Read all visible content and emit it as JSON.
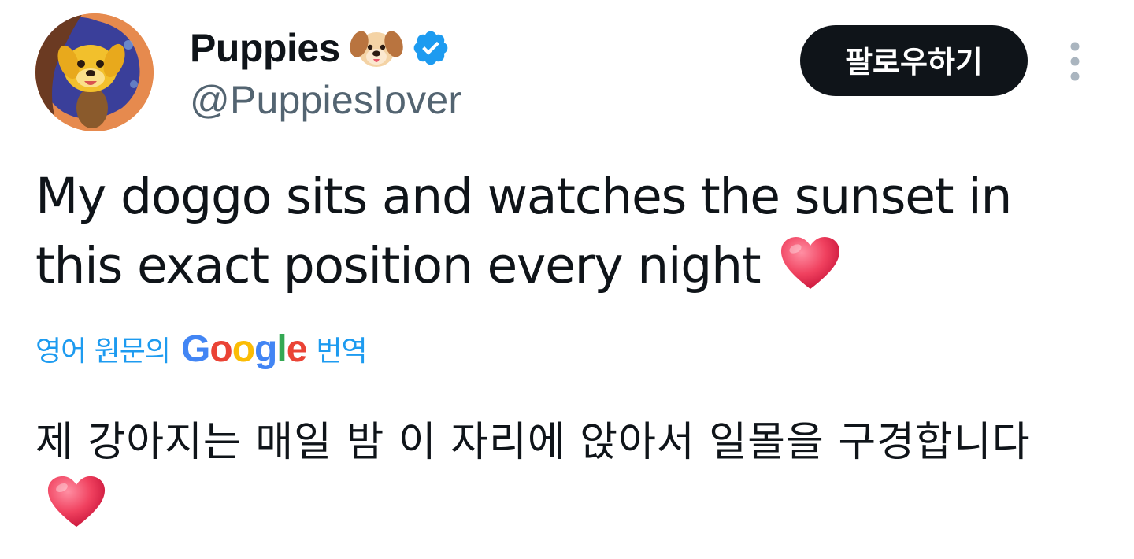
{
  "author": {
    "display_name": "Puppies",
    "handle": "@PuppiesIover",
    "name_emoji": "dog-face-emoji",
    "verified": true
  },
  "actions": {
    "follow_label": "팔로우하기",
    "more_icon": "more-vertical-icon"
  },
  "tweet": {
    "text": "My doggo sits and watches the sunset in this exact position every night",
    "trailing_emoji": "red-heart-emoji"
  },
  "translation": {
    "prefix": "영어 원문의",
    "provider": {
      "letters": [
        "G",
        "o",
        "o",
        "g",
        "l",
        "e"
      ],
      "colors": [
        "#4285F4",
        "#EA4335",
        "#FBBC05",
        "#4285F4",
        "#34A853",
        "#EA4335"
      ]
    },
    "suffix": "번역",
    "translated_text": "제 강아지는 매일 밤 이 자리에 앉아서 일몰을 구경합니다",
    "trailing_emoji": "red-heart-emoji"
  },
  "colors": {
    "text_primary": "#0f1419",
    "text_secondary": "#536471",
    "accent": "#1d9bf0",
    "follow_bg": "#0f1419",
    "verified": "#1d9bf0"
  }
}
